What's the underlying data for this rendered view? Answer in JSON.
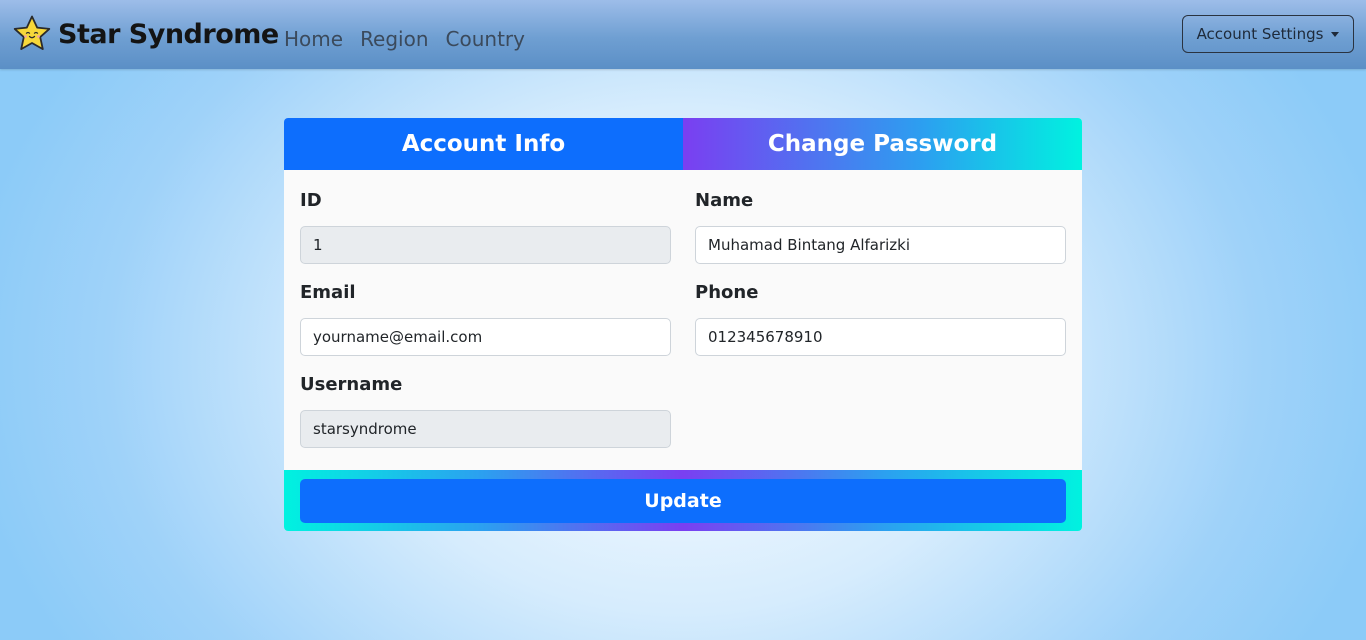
{
  "navbar": {
    "brand": "Star Syndrome",
    "brand_logo_icon": "star-face-icon",
    "links": [
      "Home",
      "Region",
      "Country"
    ],
    "account_button": "Account Settings"
  },
  "tabs": {
    "account_info": "Account Info",
    "change_password": "Change Password"
  },
  "form": {
    "id": {
      "label": "ID",
      "value": "1"
    },
    "name": {
      "label": "Name",
      "value": "Muhamad Bintang Alfarizki"
    },
    "email": {
      "label": "Email",
      "value": "yourname@email.com"
    },
    "phone": {
      "label": "Phone",
      "value": "012345678910"
    },
    "username": {
      "label": "Username",
      "value": "starsyndrome"
    }
  },
  "update_button": "Update",
  "colors": {
    "primary": "#0d6efd",
    "gradient_purple": "#7a3ff1",
    "gradient_cyan": "#00f2e0",
    "star_yellow": "#f7d83a"
  }
}
